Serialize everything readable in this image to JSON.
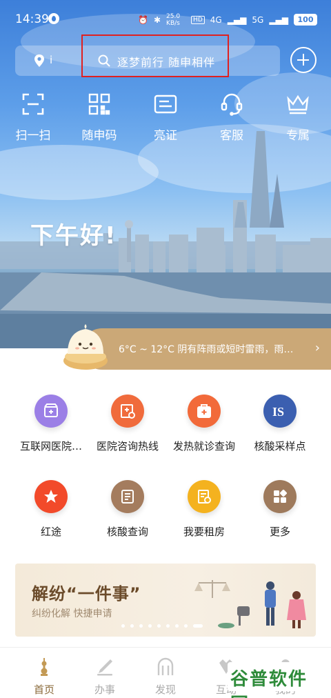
{
  "status": {
    "time": "14:39",
    "net_speed": "25.0 KB/s",
    "hd": "HD",
    "signal1": "4G",
    "signal2": "5G",
    "battery": "100"
  },
  "search": {
    "location_text": "i",
    "placeholder": "逐梦前行 随申相伴"
  },
  "quick_actions": [
    {
      "label": "扫一扫",
      "icon": "scan-icon"
    },
    {
      "label": "随申码",
      "icon": "qr-code-icon"
    },
    {
      "label": "亮证",
      "icon": "id-card-icon"
    },
    {
      "label": "客服",
      "icon": "headset-icon"
    },
    {
      "label": "专属",
      "icon": "crown-icon"
    }
  ],
  "greeting": "下午好!",
  "weather": {
    "text": "6°C ~ 12°C  阴有阵雨或短时雷雨，雨…"
  },
  "services": [
    {
      "label": "互联网医院…",
      "icon": "online-hospital-icon",
      "color": "#9b7fe6"
    },
    {
      "label": "医院咨询热线",
      "icon": "hospital-hotline-icon",
      "color": "#f06b3c"
    },
    {
      "label": "发热就诊查询",
      "icon": "fever-clinic-icon",
      "color": "#f26a3a"
    },
    {
      "label": "核酸采样点",
      "icon": "nucleic-site-icon",
      "color": "#3b5fb0"
    },
    {
      "label": "红途",
      "icon": "red-route-icon",
      "color": "#f24a2a"
    },
    {
      "label": "核酸查询",
      "icon": "nucleic-query-icon",
      "color": "#a47c5e"
    },
    {
      "label": "我要租房",
      "icon": "rent-house-icon",
      "color": "#f4b21f"
    },
    {
      "label": "更多",
      "icon": "more-apps-icon",
      "color": "#9e7a5c"
    }
  ],
  "banner": {
    "title": "解纷“一件事”",
    "subtitle": "纠纷化解 快捷申请"
  },
  "tabs": [
    {
      "label": "首页",
      "icon": "home-tower-icon",
      "active": true
    },
    {
      "label": "办事",
      "icon": "pen-icon",
      "active": false
    },
    {
      "label": "发现",
      "icon": "discover-icon",
      "active": false
    },
    {
      "label": "互动",
      "icon": "interact-icon",
      "active": false
    },
    {
      "label": "我的",
      "icon": "profile-icon",
      "active": false
    }
  ],
  "watermark": "谷普软件园",
  "colors": {
    "accent_gold": "#cba877",
    "tab_active": "#8a6a3a",
    "highlight_box": "#e02020"
  }
}
